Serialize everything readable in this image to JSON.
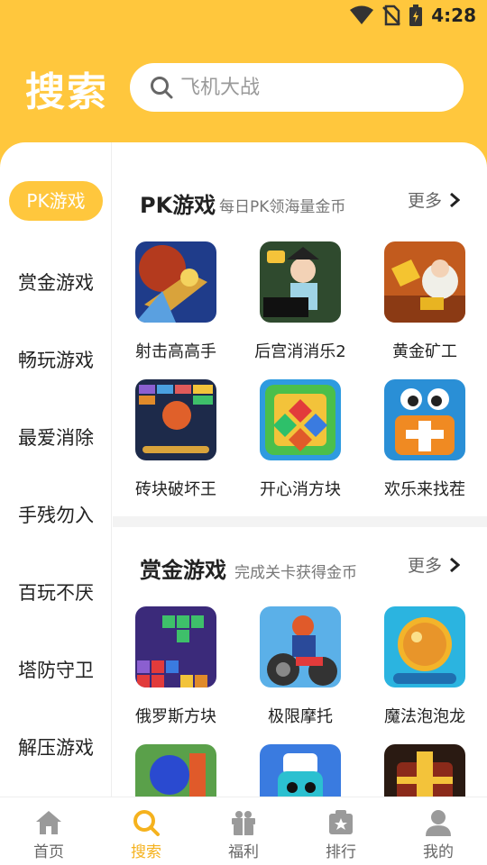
{
  "status": {
    "time": "4:28"
  },
  "header": {
    "title": "搜索"
  },
  "search": {
    "placeholder": "飞机大战"
  },
  "sidebar": {
    "items": [
      {
        "label": "PK游戏",
        "active": true
      },
      {
        "label": "赏金游戏"
      },
      {
        "label": "畅玩游戏"
      },
      {
        "label": "最爱消除"
      },
      {
        "label": "手残勿入"
      },
      {
        "label": "百玩不厌"
      },
      {
        "label": "塔防守卫"
      },
      {
        "label": "解压游戏"
      }
    ]
  },
  "sections": [
    {
      "title": "PK游戏",
      "subtitle": "每日PK领海量金币",
      "more": "更多",
      "games": [
        {
          "name": "射击高高手",
          "icon": "shooter-game-icon"
        },
        {
          "name": "后宫消消乐2",
          "icon": "palace-match-game-icon"
        },
        {
          "name": "黄金矿工",
          "icon": "gold-miner-game-icon"
        },
        {
          "name": "砖块破坏王",
          "icon": "brick-breaker-game-icon"
        },
        {
          "name": "开心消方块",
          "icon": "happy-blocks-game-icon"
        },
        {
          "name": "欢乐来找茬",
          "icon": "spot-difference-game-icon"
        }
      ]
    },
    {
      "title": "赏金游戏",
      "subtitle": "完成关卡获得金币",
      "more": "更多",
      "games": [
        {
          "name": "俄罗斯方块",
          "icon": "tetris-game-icon"
        },
        {
          "name": "极限摩托",
          "icon": "moto-game-icon"
        },
        {
          "name": "魔法泡泡龙",
          "icon": "bubble-dragon-game-icon"
        },
        {
          "name": "",
          "icon": "ball-game-icon"
        },
        {
          "name": "",
          "icon": "runner-game-icon"
        },
        {
          "name": "",
          "icon": "treasure-game-icon"
        }
      ]
    }
  ],
  "bottom_nav": {
    "items": [
      {
        "label": "首页",
        "icon": "home-icon"
      },
      {
        "label": "搜索",
        "icon": "search-icon",
        "active": true
      },
      {
        "label": "福利",
        "icon": "gift-icon"
      },
      {
        "label": "排行",
        "icon": "rank-icon"
      },
      {
        "label": "我的",
        "icon": "profile-icon"
      }
    ]
  },
  "colors": {
    "accent": "#FFC73D",
    "active_text": "#F5B21E"
  }
}
